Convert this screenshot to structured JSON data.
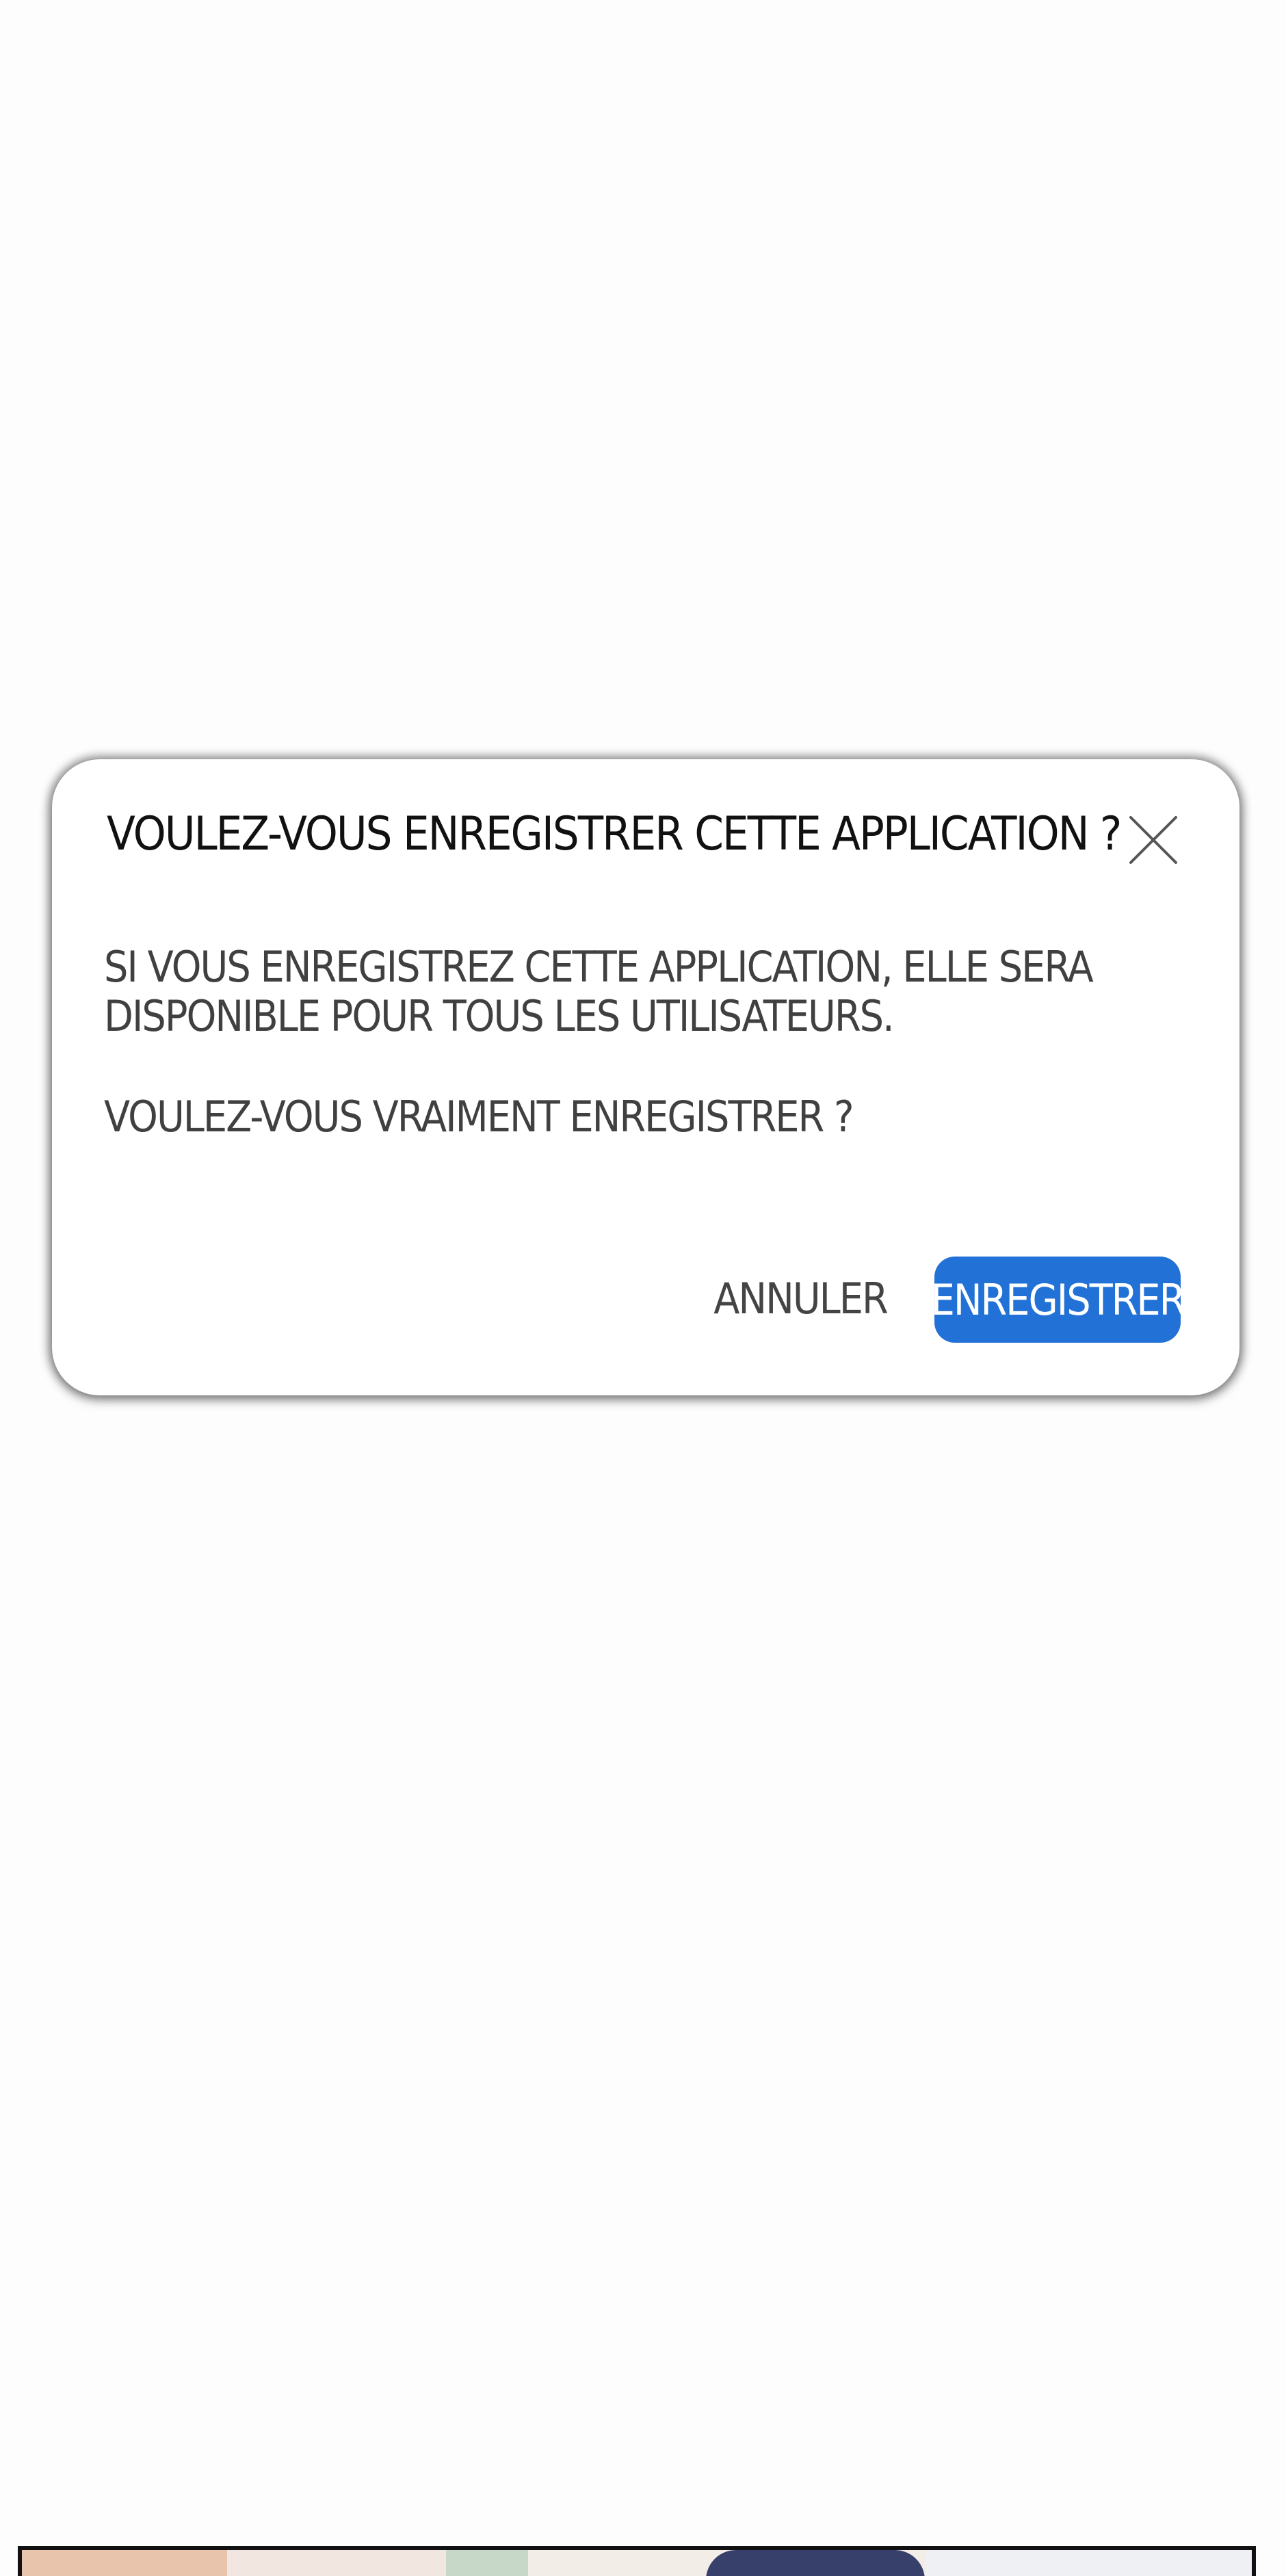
{
  "dialog": {
    "title": "VOULEZ-VOUS ENREGISTRER CETTE APPLICATION ?",
    "message": "SI VOUS ENREGISTREZ CETTE APPLICATION, ELLE SERA DISPONIBLE POUR TOUS LES UTILISATEURS.",
    "question": "VOULEZ-VOUS VRAIMENT ENREGISTRER ?",
    "close_icon": "close-icon",
    "cancel_label": "ANNULER",
    "save_label": "ENREGISTRER"
  },
  "colors": {
    "primary": "#2271d6",
    "title_text": "#111111",
    "body_text": "#404040",
    "background": "#fdfdfd"
  }
}
